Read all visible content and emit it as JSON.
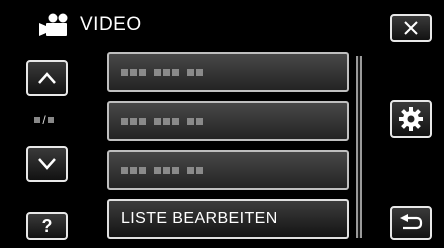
{
  "header": {
    "title": "VIDEO",
    "icon": "video-camera-icon"
  },
  "nav": {
    "close_icon": "close-icon",
    "scroll_up_icon": "chevron-up-icon",
    "scroll_down_icon": "chevron-down-icon",
    "help_label": "?",
    "settings_icon": "gear-icon",
    "back_icon": "return-arrow-icon",
    "page_separator": "/"
  },
  "list": {
    "items": [
      {
        "type": "placeholder"
      },
      {
        "type": "placeholder"
      },
      {
        "type": "placeholder"
      },
      {
        "type": "action",
        "label": "LISTE BEARBEITEN"
      }
    ]
  },
  "colors": {
    "background": "#000000",
    "border": "#e8e8e8",
    "text": "#ffffff"
  }
}
